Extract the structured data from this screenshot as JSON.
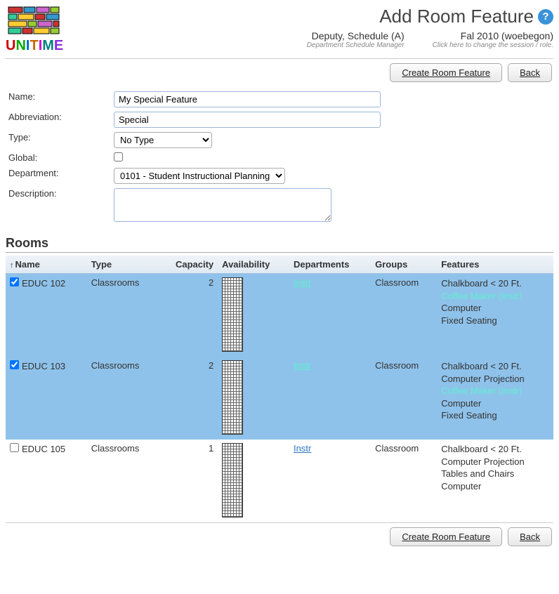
{
  "header": {
    "page_title": "Add Room Feature",
    "logo_text": "UniTime",
    "user_name": "Deputy, Schedule (A)",
    "user_role": "Department Schedule Manager",
    "session_name": "Fal 2010 (woebegon)",
    "session_hint": "Click here to change the session / role."
  },
  "buttons": {
    "create": "Create Room Feature",
    "back": "Back"
  },
  "form": {
    "labels": {
      "name": "Name:",
      "abbreviation": "Abbreviation:",
      "type": "Type:",
      "global": "Global:",
      "department": "Department:",
      "description": "Description:"
    },
    "name_value": "My Special Feature",
    "abbreviation_value": "Special",
    "type_value": "No Type",
    "global_checked": false,
    "department_value": "0101 - Student Instructional Planning",
    "description_value": ""
  },
  "rooms_section": {
    "title": "Rooms",
    "columns": {
      "name": "Name",
      "type": "Type",
      "capacity": "Capacity",
      "availability": "Availability",
      "departments": "Departments",
      "groups": "Groups",
      "features": "Features"
    },
    "rows": [
      {
        "checked": true,
        "name": "EDUC 102",
        "type": "Classrooms",
        "capacity": "2",
        "department": "Instr",
        "groups": "Classroom",
        "features": [
          {
            "text": "Chalkboard < 20 Ft.",
            "hl": false
          },
          {
            "text": "Coffee Maker (Instr)",
            "hl": true
          },
          {
            "text": "Computer",
            "hl": false
          },
          {
            "text": "Fixed Seating",
            "hl": false
          }
        ]
      },
      {
        "checked": true,
        "name": "EDUC 103",
        "type": "Classrooms",
        "capacity": "2",
        "department": "Instr",
        "groups": "Classroom",
        "features": [
          {
            "text": "Chalkboard < 20 Ft.",
            "hl": false
          },
          {
            "text": "Computer Projection",
            "hl": false
          },
          {
            "text": "Coffee Maker (Instr)",
            "hl": true
          },
          {
            "text": "Computer",
            "hl": false
          },
          {
            "text": "Fixed Seating",
            "hl": false
          }
        ]
      },
      {
        "checked": false,
        "name": "EDUC 105",
        "type": "Classrooms",
        "capacity": "1",
        "department": "Instr",
        "groups": "Classroom",
        "features": [
          {
            "text": "Chalkboard < 20 Ft.",
            "hl": false
          },
          {
            "text": "Computer Projection",
            "hl": false
          },
          {
            "text": "Tables and Chairs",
            "hl": false
          },
          {
            "text": "Computer",
            "hl": false
          }
        ]
      }
    ]
  }
}
